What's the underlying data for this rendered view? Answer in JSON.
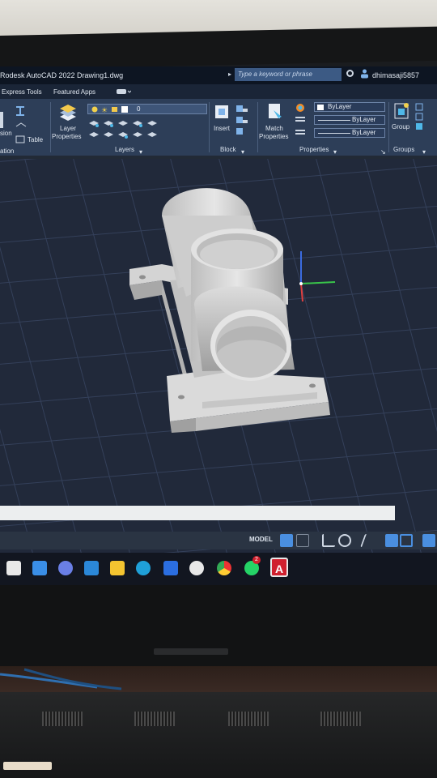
{
  "window": {
    "title": "Rodesk AutoCAD 2022   Drawing1.dwg",
    "search_placeholder": "Type a keyword or phrase",
    "user": "dhimasaji5857"
  },
  "ribbon": {
    "tabs": [
      "Express Tools",
      "Featured Apps"
    ],
    "left_labels": [
      "sion",
      "Table",
      "ation"
    ],
    "layer_properties_label_1": "Layer",
    "layer_properties_label_2": "Properties",
    "layer_current": "0",
    "layers_panel_title": "Layers",
    "insert_label": "Insert",
    "block_panel_title": "Block",
    "match_label_1": "Match",
    "match_label_2": "Properties",
    "prop_color": "ByLayer",
    "prop_linetype": "ByLayer",
    "prop_lineweight": "ByLayer",
    "properties_panel_title": "Properties",
    "group_label": "Group",
    "groups_panel_title": "Groups"
  },
  "statusbar": {
    "model_label": "MODEL"
  },
  "taskbar": {
    "apps": [
      "task-view",
      "widgets",
      "chat",
      "mail",
      "file-explorer",
      "edge",
      "store",
      "xbox",
      "chrome",
      "whatsapp",
      "autocad"
    ],
    "whatsapp_badge": "2",
    "autocad_letter": "A"
  },
  "colors": {
    "titlebar": "#0d1522",
    "ribbon": "#2d3e58",
    "viewport": "#21293a",
    "grid_line": "#34405a",
    "model_gray": "#c8c8c8",
    "autocad_red": "#d0202e"
  }
}
